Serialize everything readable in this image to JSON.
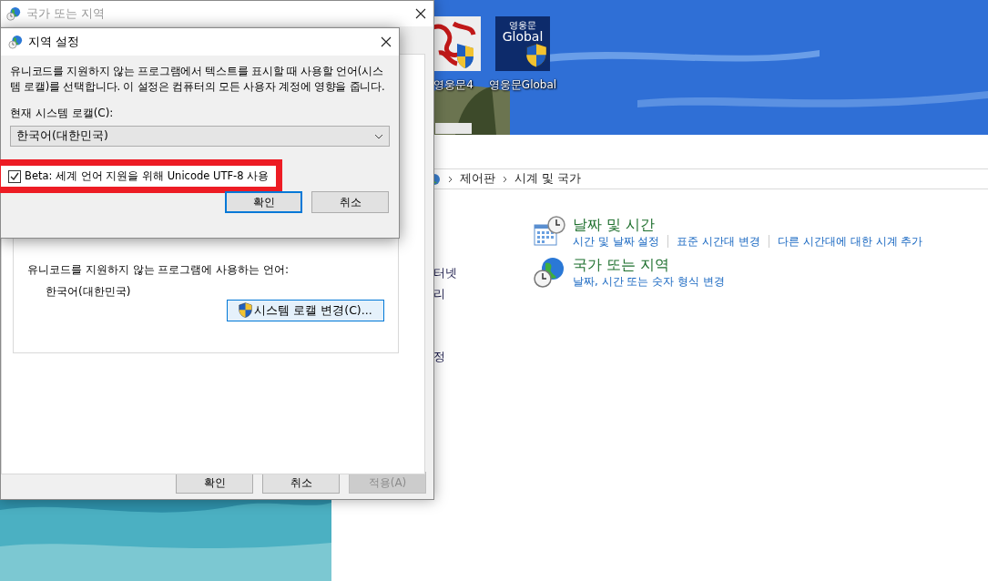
{
  "desktop": {
    "icons": [
      {
        "label": "영웅문4",
        "kind": "calligraphy"
      },
      {
        "label": "영웅문Global",
        "kind": "global",
        "logo_lines": [
          "영웅문",
          "Global"
        ]
      }
    ]
  },
  "control_panel": {
    "breadcrumb": [
      "제어판",
      "시계 및 국가"
    ],
    "sidebar_fragments": [
      "터넷",
      "리",
      "정"
    ],
    "categories": [
      {
        "kind": "clock",
        "title": "날짜 및 시간",
        "links": [
          "시간 및 날짜 설정",
          "표준 시간대 변경",
          "다른 시간대에 대한 시계 추가"
        ]
      },
      {
        "kind": "globe",
        "title": "국가 또는 지역",
        "links": [
          "날짜, 시간 또는 숫자 형식 변경"
        ]
      }
    ]
  },
  "region_window": {
    "title": "국가 또는 지역",
    "language_label": "유니코드를 지원하지 않는 프로그램에 사용하는 언어:",
    "language_value": "한국어(대한민국)",
    "change_locale_button": "시스템 로캘 변경(C)...",
    "buttons": [
      {
        "label": "확인",
        "disabled": false
      },
      {
        "label": "취소",
        "disabled": false
      },
      {
        "label": "적용(A)",
        "disabled": true
      }
    ]
  },
  "locale_dialog": {
    "title": "지역 설정",
    "description": "유니코드를 지원하지 않는 프로그램에서 텍스트를 표시할 때 사용할 언어(시스템 로캘)를 선택합니다. 이 설정은 컴퓨터의 모든 사용자 계정에 영향을 줍니다.",
    "locale_label": "현재 시스템 로캘(C):",
    "locale_value": "한국어(대한민국)",
    "beta_option": {
      "label": "Beta: 세계 언어 지원을 위해 Unicode UTF-8 사용",
      "checked": true,
      "highlighted": true
    },
    "buttons": [
      {
        "label": "확인",
        "default": true
      },
      {
        "label": "취소",
        "default": false
      }
    ]
  }
}
